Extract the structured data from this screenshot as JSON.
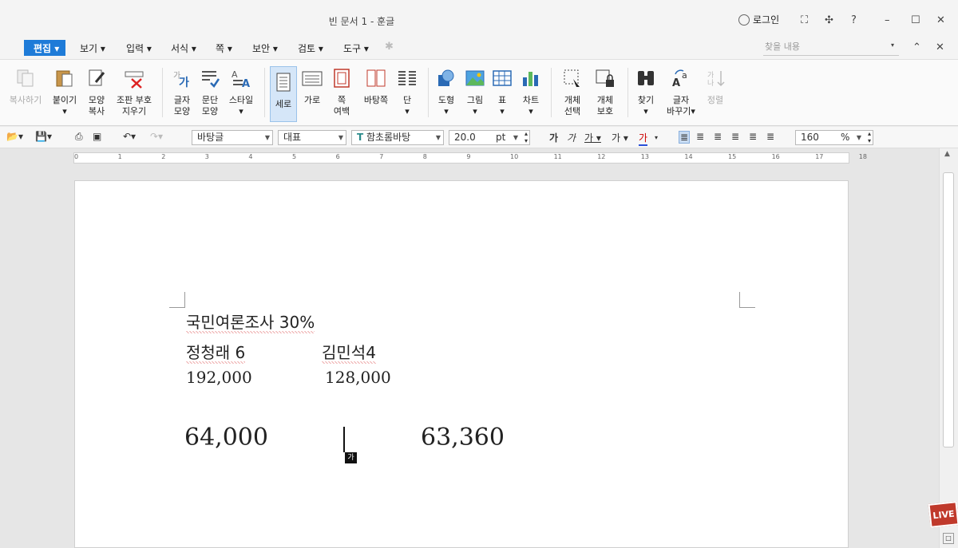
{
  "window": {
    "title": "빈 문서 1 - 훈글",
    "login": "로그인",
    "help": "?"
  },
  "menus": [
    {
      "label": "편집",
      "active": true
    },
    {
      "label": "보기"
    },
    {
      "label": "입력"
    },
    {
      "label": "서식"
    },
    {
      "label": "쪽"
    },
    {
      "label": "보안"
    },
    {
      "label": "검토"
    },
    {
      "label": "도구"
    }
  ],
  "search": {
    "placeholder": "찾을 내용"
  },
  "ribbon": [
    {
      "label": "복사하기",
      "sub": "",
      "icon": "copy-icon"
    },
    {
      "label": "붙이기",
      "sub": "",
      "icon": "paste-icon"
    },
    {
      "label": "모양",
      "sub": "복사",
      "icon": "format-painter-icon"
    },
    {
      "label": "조판 부호",
      "sub": "지우기",
      "icon": "clear-markup-icon"
    },
    {
      "label": "글자",
      "sub": "모양",
      "icon": "char-shape-icon"
    },
    {
      "label": "문단",
      "sub": "모양",
      "icon": "paragraph-shape-icon"
    },
    {
      "label": "스타일",
      "sub": "",
      "icon": "style-icon"
    },
    {
      "label": "세로",
      "sub": "",
      "icon": "portrait-icon"
    },
    {
      "label": "가로",
      "sub": "",
      "icon": "landscape-icon"
    },
    {
      "label": "쪽",
      "sub": "여백",
      "icon": "page-margin-icon"
    },
    {
      "label": "바탕쪽",
      "sub": "",
      "icon": "master-page-icon"
    },
    {
      "label": "단",
      "sub": "",
      "icon": "columns-icon"
    },
    {
      "label": "도형",
      "sub": "",
      "icon": "shape-icon"
    },
    {
      "label": "그림",
      "sub": "",
      "icon": "picture-icon"
    },
    {
      "label": "표",
      "sub": "",
      "icon": "table-icon"
    },
    {
      "label": "차트",
      "sub": "",
      "icon": "chart-icon"
    },
    {
      "label": "개체",
      "sub": "선택",
      "icon": "object-select-icon"
    },
    {
      "label": "개체",
      "sub": "보호",
      "icon": "object-protect-icon"
    },
    {
      "label": "찾기",
      "sub": "",
      "icon": "find-icon"
    },
    {
      "label": "글자",
      "sub": "바꾸기",
      "icon": "replace-icon"
    },
    {
      "label": "정렬",
      "sub": "",
      "icon": "sort-icon"
    }
  ],
  "format": {
    "style": "바탕글",
    "lang": "대표",
    "font": "함초롬바탕",
    "size": "20.0",
    "unit": "pt",
    "zoom": "160",
    "zoom_unit": "%",
    "font_icon": "T"
  },
  "ruler": [
    "0",
    "1",
    "2",
    "3",
    "4",
    "5",
    "6",
    "7",
    "8",
    "9",
    "10",
    "11",
    "12",
    "13",
    "14",
    "15",
    "16",
    "17",
    "18"
  ],
  "document": {
    "line1": "국민여론조사  30%",
    "line2a": "정청래  6",
    "line2b": "김민석4",
    "line3a": "192,000",
    "line3b": "128,000",
    "line4a": "64,000",
    "line4b": "63,360",
    "ime": "가"
  },
  "badge": "LIVE"
}
